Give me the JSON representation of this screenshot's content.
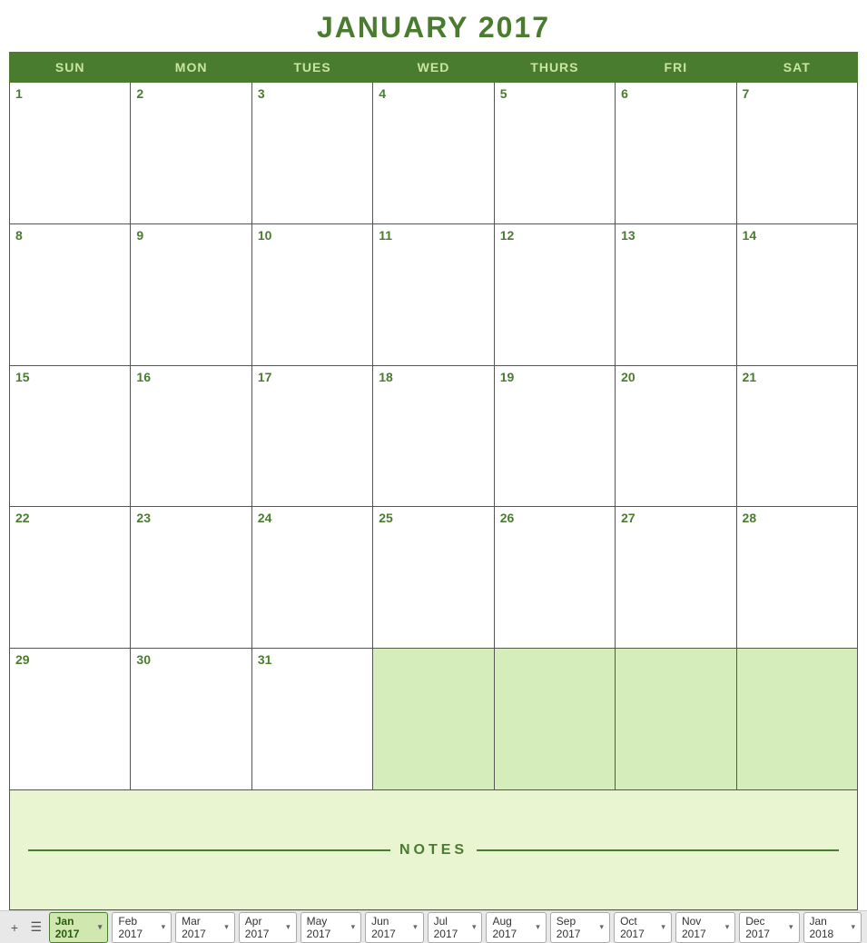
{
  "title": "JANUARY 2017",
  "headers": [
    "SUN",
    "MON",
    "TUES",
    "WED",
    "THURS",
    "FRI",
    "SAT"
  ],
  "weeks": [
    [
      {
        "day": "1",
        "overflow": false
      },
      {
        "day": "2",
        "overflow": false
      },
      {
        "day": "3",
        "overflow": false
      },
      {
        "day": "4",
        "overflow": false
      },
      {
        "day": "5",
        "overflow": false
      },
      {
        "day": "6",
        "overflow": false
      },
      {
        "day": "7",
        "overflow": false
      }
    ],
    [
      {
        "day": "8",
        "overflow": false
      },
      {
        "day": "9",
        "overflow": false
      },
      {
        "day": "10",
        "overflow": false
      },
      {
        "day": "11",
        "overflow": false
      },
      {
        "day": "12",
        "overflow": false
      },
      {
        "day": "13",
        "overflow": false
      },
      {
        "day": "14",
        "overflow": false
      }
    ],
    [
      {
        "day": "15",
        "overflow": false
      },
      {
        "day": "16",
        "overflow": false
      },
      {
        "day": "17",
        "overflow": false
      },
      {
        "day": "18",
        "overflow": false
      },
      {
        "day": "19",
        "overflow": false
      },
      {
        "day": "20",
        "overflow": false
      },
      {
        "day": "21",
        "overflow": false
      }
    ],
    [
      {
        "day": "22",
        "overflow": false
      },
      {
        "day": "23",
        "overflow": false
      },
      {
        "day": "24",
        "overflow": false
      },
      {
        "day": "25",
        "overflow": false
      },
      {
        "day": "26",
        "overflow": false
      },
      {
        "day": "27",
        "overflow": false
      },
      {
        "day": "28",
        "overflow": false
      }
    ],
    [
      {
        "day": "29",
        "overflow": false
      },
      {
        "day": "30",
        "overflow": false
      },
      {
        "day": "31",
        "overflow": false
      },
      {
        "day": "",
        "overflow": true
      },
      {
        "day": "",
        "overflow": true
      },
      {
        "day": "",
        "overflow": true
      },
      {
        "day": "",
        "overflow": true
      }
    ]
  ],
  "notes_label": "NOTES",
  "bottom_tabs": [
    {
      "label": "Jan 2017",
      "active": true
    },
    {
      "label": "Feb 2017",
      "active": false
    },
    {
      "label": "Mar 2017",
      "active": false
    },
    {
      "label": "Apr 2017",
      "active": false
    },
    {
      "label": "May 2017",
      "active": false
    },
    {
      "label": "Jun 2017",
      "active": false
    },
    {
      "label": "Jul 2017",
      "active": false
    },
    {
      "label": "Aug 2017",
      "active": false
    },
    {
      "label": "Sep 2017",
      "active": false
    },
    {
      "label": "Oct 2017",
      "active": false
    },
    {
      "label": "Nov 2017",
      "active": false
    },
    {
      "label": "Dec 2017",
      "active": false
    },
    {
      "label": "Jan 2018",
      "active": false
    }
  ],
  "add_icon": "+",
  "list_icon": "☰"
}
